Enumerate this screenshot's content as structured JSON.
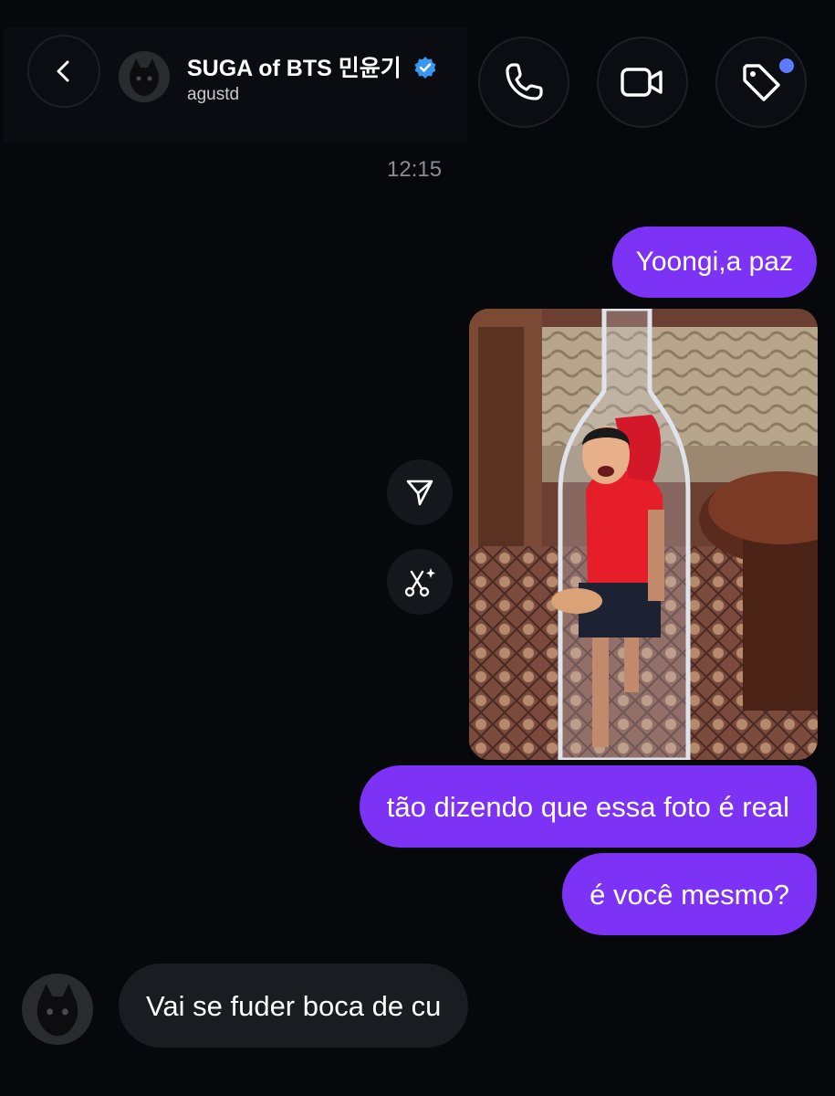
{
  "header": {
    "contact_name": "SUGA of BTS 민윤기",
    "contact_handle": "agustd",
    "verified": true,
    "back_icon": "chevron-left-icon",
    "call_icon": "phone-icon",
    "video_icon": "video-camera-icon",
    "tag_icon": "tag-icon",
    "tag_notification": true
  },
  "conversation": {
    "timestamp": "12:15",
    "messages": [
      {
        "from": "me",
        "type": "text",
        "text": "Yoongi,a paz"
      },
      {
        "from": "me",
        "type": "image",
        "description": "photo of a person in red shirt inside a bottle outline"
      },
      {
        "from": "me",
        "type": "text",
        "text": "tão dizendo que essa foto é real"
      },
      {
        "from": "me",
        "type": "text",
        "text": "é você mesmo?"
      },
      {
        "from": "them",
        "type": "text",
        "text": "Vai se fuder boca de cu"
      }
    ]
  },
  "media_actions": {
    "share_icon": "send-icon",
    "cutout_icon": "scissors-sparkle-icon"
  },
  "colors": {
    "background": "#07080c",
    "sent_bubble": "#7d33f5",
    "received_bubble": "#1b1c22",
    "verified_badge": "#3897f0",
    "notification_dot": "#5b7cff"
  }
}
